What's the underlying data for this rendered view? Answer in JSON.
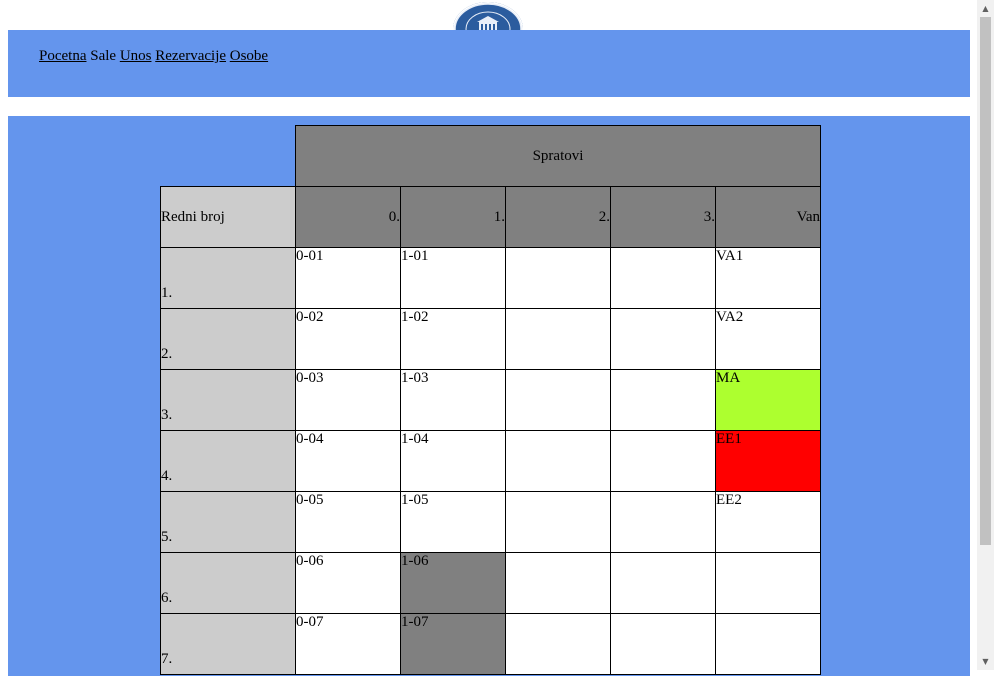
{
  "logo": {
    "name": "university-seal"
  },
  "nav": {
    "items": [
      {
        "label": "Pocetna",
        "link": true
      },
      {
        "label": "Sale",
        "link": false
      },
      {
        "label": "Unos",
        "link": true
      },
      {
        "label": "Rezervacije",
        "link": true
      },
      {
        "label": "Osobe",
        "link": true
      }
    ]
  },
  "table": {
    "group_header": "Spratovi",
    "row_header": "Redni broj",
    "floors": [
      "0.",
      "1.",
      "2.",
      "3.",
      "Van"
    ],
    "rows": [
      {
        "num": "1.",
        "cells": [
          "0-01",
          "1-01",
          "",
          "",
          "VA1"
        ],
        "colors": [
          "",
          "",
          "",
          "",
          ""
        ]
      },
      {
        "num": "2.",
        "cells": [
          "0-02",
          "1-02",
          "",
          "",
          "VA2"
        ],
        "colors": [
          "",
          "",
          "",
          "",
          ""
        ]
      },
      {
        "num": "3.",
        "cells": [
          "0-03",
          "1-03",
          "",
          "",
          "MA"
        ],
        "colors": [
          "",
          "",
          "",
          "",
          "green"
        ]
      },
      {
        "num": "4.",
        "cells": [
          "0-04",
          "1-04",
          "",
          "",
          "EE1"
        ],
        "colors": [
          "",
          "",
          "",
          "",
          "red"
        ]
      },
      {
        "num": "5.",
        "cells": [
          "0-05",
          "1-05",
          "",
          "",
          "EE2"
        ],
        "colors": [
          "",
          "",
          "",
          "",
          ""
        ]
      },
      {
        "num": "6.",
        "cells": [
          "0-06",
          "1-06",
          "",
          "",
          ""
        ],
        "colors": [
          "",
          "gray",
          "",
          "",
          ""
        ]
      },
      {
        "num": "7.",
        "cells": [
          "0-07",
          "1-07",
          "",
          "",
          ""
        ],
        "colors": [
          "",
          "gray",
          "",
          "",
          ""
        ]
      }
    ]
  },
  "colors": {
    "band": "#6495ed",
    "header_gray": "#808080",
    "row_gray": "#cccccc",
    "green": "#adff2f",
    "red": "#ff0000"
  },
  "scrollbar": {
    "up_icon": "arrow-up-icon",
    "down_icon": "arrow-down-icon"
  }
}
